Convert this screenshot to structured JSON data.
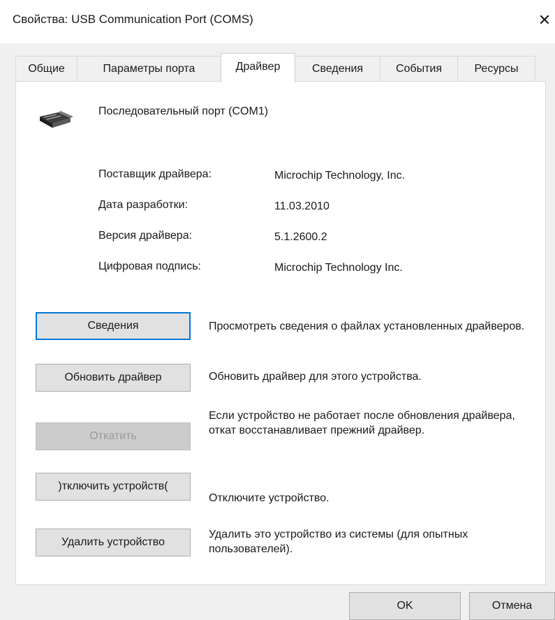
{
  "window": {
    "title": "Свойства: USB Communication Port (COMS)",
    "close_symbol": "✕"
  },
  "tabs": [
    {
      "label": "Общие",
      "active": false
    },
    {
      "label": "Параметры порта",
      "active": false
    },
    {
      "label": "Драйвер",
      "active": true
    },
    {
      "label": "Сведения",
      "active": false
    },
    {
      "label": "События",
      "active": false
    },
    {
      "label": "Ресурсы",
      "active": false
    }
  ],
  "device": {
    "icon": "serial-port-icon",
    "name": "Последовательный порт (COM1)"
  },
  "properties": [
    {
      "label": "Поставщик драйвера:",
      "value": "Microchip Technology, Inc."
    },
    {
      "label": "Дата разработки:",
      "value": "11.03.2010"
    },
    {
      "label": "Версия драйвера:",
      "value": "5.1.2600.2"
    },
    {
      "label": "Цифровая подпись:",
      "value": "Microchip Technology Inc."
    }
  ],
  "actions": [
    {
      "label": "Сведения",
      "desc": "Просмотреть сведения о файлах установленных драйверов.",
      "state": "focused"
    },
    {
      "label": "Обновить драйвер",
      "desc": "Обновить драйвер для этого устройства.",
      "state": "normal"
    },
    {
      "label": "Откатить",
      "desc": "Если устройство не работает после обновления драйвера, откат восстанавливает прежний драйвер.",
      "state": "disabled"
    },
    {
      "label": ")тключить устройств(",
      "desc": "Отключите устройство.",
      "state": "normal"
    },
    {
      "label": "Удалить устройство",
      "desc": "Удалить это устройство из системы (для опытных пользователей).",
      "state": "normal"
    }
  ],
  "footer": {
    "ok_label": "OK",
    "cancel_label": "Отмена"
  },
  "colors": {
    "focus_border": "#0078d7",
    "dialog_bg": "#f0f0f0",
    "button_bg": "#e1e1e1"
  }
}
